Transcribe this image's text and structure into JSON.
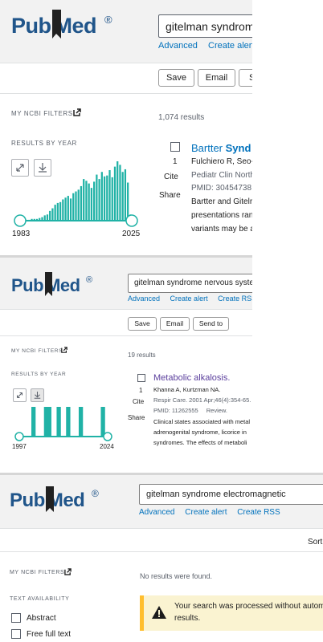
{
  "panel1": {
    "logo": {
      "text_left": "Pub",
      "text_right": "Med",
      "reg": "®"
    },
    "search": {
      "value": "gitelman syndrome"
    },
    "links": [
      "Advanced",
      "Create alert",
      "C"
    ],
    "buttons": [
      "Save",
      "Email",
      "S"
    ],
    "filters_label": "MY NCBI FILTERS",
    "results_count": "1,074 results",
    "results_by_year_label": "RESULTS BY YEAR",
    "year_start": "1983",
    "year_end": "2025",
    "result": {
      "title_plain": "Bartter ",
      "title_bold": "Synd",
      "number": "1",
      "authors": "Fulchiero R, Seo-I",
      "journal": "Pediatr Clin North",
      "pmid": "PMID: 30454738",
      "cite": "Cite",
      "share": "Share",
      "snippet_lines": [
        "Bartter and Gitelr",
        "presentations ran",
        "variants may be a"
      ]
    },
    "chart_data": {
      "type": "bar",
      "title": "",
      "xlabel": "",
      "ylabel": "",
      "x_range": [
        1983,
        2025
      ],
      "categories": [
        "1983",
        "1984",
        "1985",
        "1986",
        "1987",
        "1988",
        "1989",
        "1990",
        "1991",
        "1992",
        "1993",
        "1994",
        "1995",
        "1996",
        "1997",
        "1998",
        "1999",
        "2000",
        "2001",
        "2002",
        "2003",
        "2004",
        "2005",
        "2006",
        "2007",
        "2008",
        "2009",
        "2010",
        "2011",
        "2012",
        "2013",
        "2014",
        "2015",
        "2016",
        "2017",
        "2018",
        "2019",
        "2020",
        "2021",
        "2022",
        "2023",
        "2024",
        "2025"
      ],
      "values": [
        1,
        0,
        1,
        1,
        2,
        2,
        2,
        3,
        4,
        6,
        7,
        11,
        14,
        18,
        20,
        21,
        24,
        26,
        28,
        25,
        31,
        33,
        35,
        39,
        47,
        45,
        42,
        37,
        44,
        52,
        47,
        55,
        50,
        51,
        57,
        49,
        61,
        67,
        63,
        55,
        58,
        43,
        7
      ],
      "colors": {
        "bar": "#20b2a6",
        "track": "#20b2a6"
      }
    }
  },
  "panel2": {
    "logo": {
      "text_left": "Pub",
      "text_right": "Med",
      "reg": "®"
    },
    "search": {
      "value": "gitelman syndrome nervous system"
    },
    "links": [
      "Advanced",
      "Create alert",
      "Create RSS"
    ],
    "buttons": [
      "Save",
      "Email",
      "Send to"
    ],
    "filters_label": "MY NCBI FILTERS",
    "results_count": "19 results",
    "results_by_year_label": "RESULTS BY YEAR",
    "year_start": "1997",
    "year_end": "2024",
    "result": {
      "title": "Metabolic alkalosis.",
      "number": "1",
      "authors": "Khanna A, Kurtzman NA.",
      "journal": "Respir Care. 2001 Apr;46(4):354-65.",
      "pmid": "PMID: 11262555",
      "pubtype": "Review.",
      "cite": "Cite",
      "share": "Share",
      "snippet_lines": [
        "Clinical states associated with metal",
        "adrenogenital syndrome, licorice in",
        "syndromes. The effects of metaboli"
      ]
    },
    "chart_data": {
      "type": "bar",
      "title": "",
      "xlabel": "",
      "ylabel": "",
      "x_range": [
        1997,
        2024
      ],
      "categories": [
        "1997",
        "1998",
        "1999",
        "2000",
        "2001",
        "2002",
        "2003",
        "2004",
        "2005",
        "2006",
        "2007",
        "2008",
        "2009",
        "2010",
        "2011",
        "2012",
        "2013",
        "2014",
        "2015",
        "2016",
        "2017",
        "2018",
        "2019",
        "2020",
        "2021",
        "2022",
        "2023",
        "2024"
      ],
      "values": [
        0,
        0,
        0,
        0,
        1,
        0,
        0,
        0,
        1,
        1,
        0,
        0,
        1,
        0,
        0,
        1,
        0,
        0,
        0,
        1,
        0,
        0,
        0,
        0,
        0,
        0,
        1,
        0
      ],
      "colors": {
        "bar": "#20b2a6",
        "track": "#20b2a6"
      }
    }
  },
  "panel3": {
    "logo": {
      "text_left": "Pub",
      "text_right": "Med",
      "reg": "®"
    },
    "search": {
      "value": "gitelman syndrome electromagnetic"
    },
    "links": [
      "Advanced",
      "Create alert",
      "Create RSS"
    ],
    "sort_label": "Sort I",
    "filters_label": "MY NCBI FILTERS",
    "no_results": "No results were found.",
    "text_availability_label": "TEXT AVAILABILITY",
    "filters": [
      "Abstract",
      "Free full text"
    ],
    "warning": {
      "line1": "Your search was processed without autom",
      "line2": "results."
    },
    "colors": {
      "warning_bg": "#faf3d1",
      "warning_border": "#ffbe2e"
    }
  }
}
